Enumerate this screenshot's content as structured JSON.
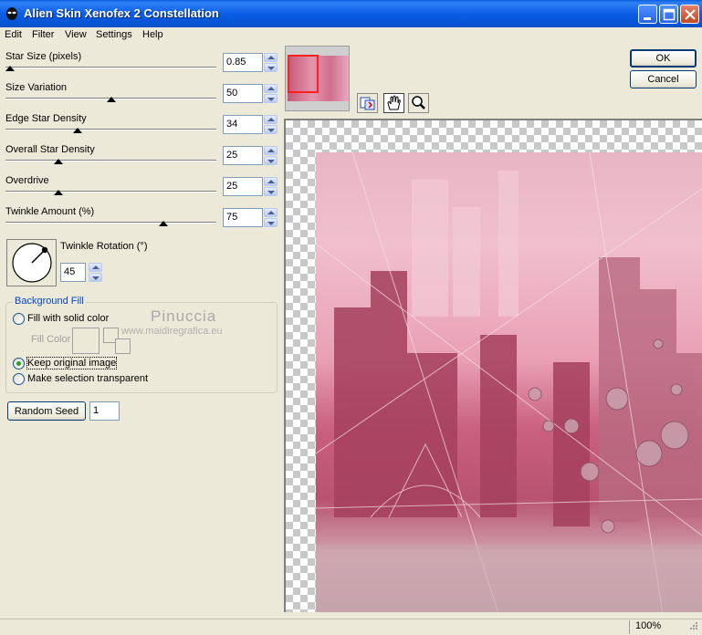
{
  "window": {
    "title": "Alien Skin Xenofex 2 Constellation"
  },
  "menu": [
    "Edit",
    "Filter",
    "View",
    "Settings",
    "Help"
  ],
  "sliders": [
    {
      "label": "Star Size (pixels)",
      "value": "0.85",
      "level": 0.02
    },
    {
      "label": "Size Variation",
      "value": "50",
      "level": 0.5
    },
    {
      "label": "Edge Star Density",
      "value": "34",
      "level": 0.34
    },
    {
      "label": "Overall Star Density",
      "value": "25",
      "level": 0.25
    },
    {
      "label": "Overdrive",
      "value": "25",
      "level": 0.25
    },
    {
      "label": "Twinkle Amount (%)",
      "value": "75",
      "level": 0.75
    }
  ],
  "twinkle_rotation": {
    "label": "Twinkle Rotation (°)",
    "value": "45"
  },
  "background_fill": {
    "title": "Background Fill",
    "options": [
      {
        "label": "Fill with solid color",
        "checked": false
      },
      {
        "label": "Keep original image",
        "checked": true
      },
      {
        "label": "Make selection transparent",
        "checked": false
      }
    ],
    "fill_color_label": "Fill Color"
  },
  "watermark": {
    "name": "Pinuccia",
    "url": "www.maidiregrafica.eu"
  },
  "random_seed": {
    "label": "Random Seed",
    "value": "1"
  },
  "buttons": {
    "ok": "OK",
    "cancel": "Cancel"
  },
  "tools": [
    "preview-toggle-icon",
    "hand-icon",
    "zoom-icon"
  ],
  "status": {
    "zoom": "100%"
  },
  "colors": {
    "titlebar": "#0a5fe0",
    "accent": "#0046d5",
    "preview": "#d47a96"
  }
}
